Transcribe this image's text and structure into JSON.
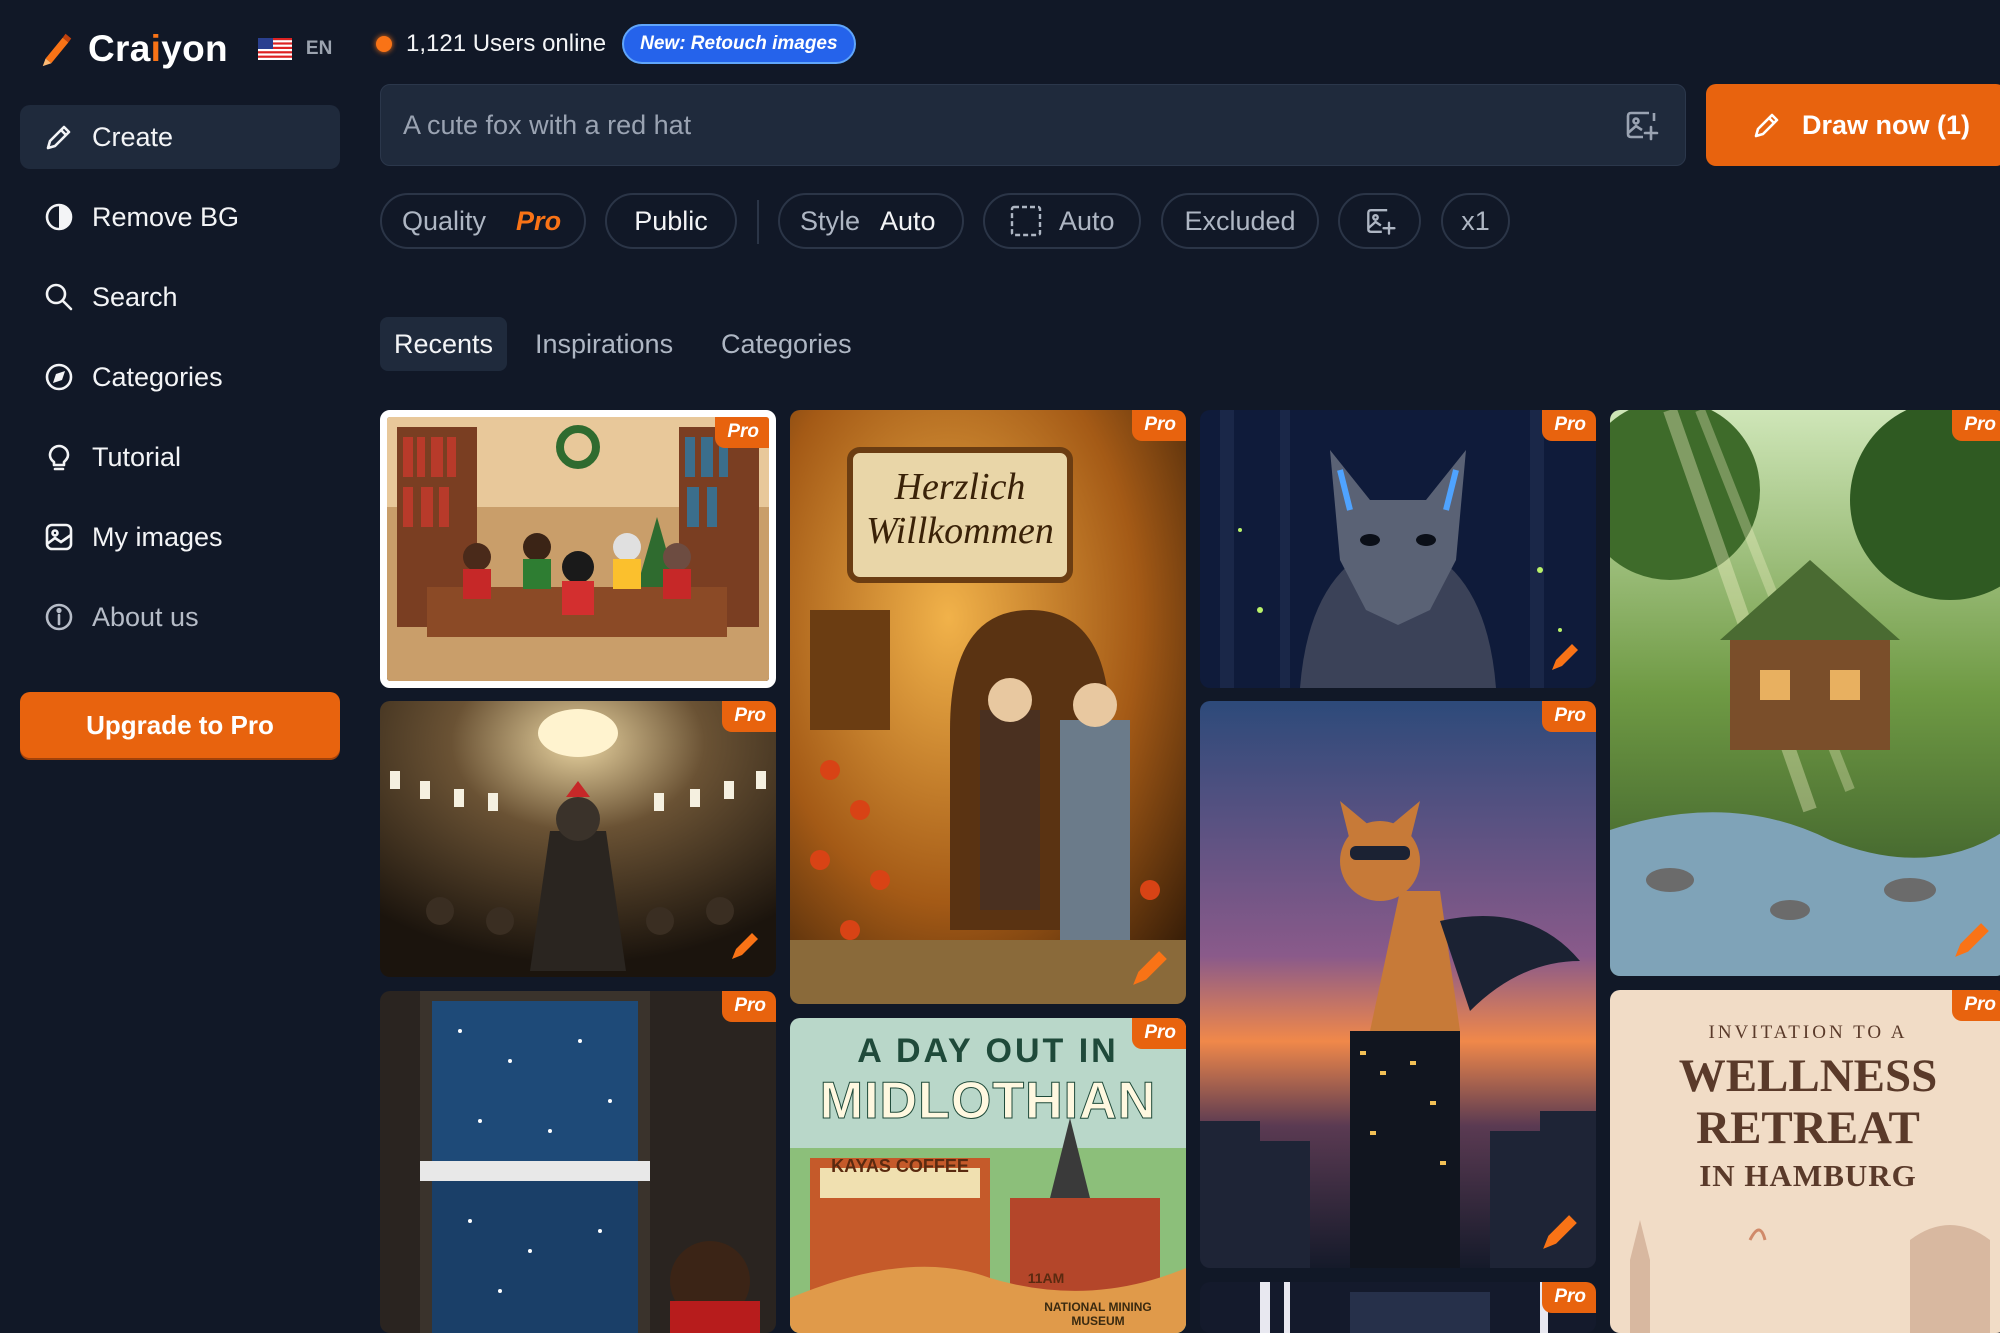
{
  "app": {
    "brand_prefix": "Cra",
    "brand_accent": "i",
    "brand_suffix": "yon",
    "language": "EN",
    "accent_color": "#e8630e"
  },
  "sidebar": {
    "items": [
      {
        "label": "Create",
        "icon": "pencil-icon",
        "active": true
      },
      {
        "label": "Remove BG",
        "icon": "half-circle-icon"
      },
      {
        "label": "Search",
        "icon": "search-icon"
      },
      {
        "label": "Categories",
        "icon": "compass-icon"
      },
      {
        "label": "Tutorial",
        "icon": "lightbulb-icon"
      },
      {
        "label": "My images",
        "icon": "image-icon"
      },
      {
        "label": "About us",
        "icon": "info-icon"
      }
    ],
    "upgrade_label": "Upgrade to Pro"
  },
  "header": {
    "users_online": "1,121 Users online",
    "badge": "New: Retouch images"
  },
  "prompt": {
    "placeholder": "A cute fox with a red hat",
    "value": ""
  },
  "draw_button": "Draw now (1)",
  "options": {
    "quality_label": "Quality",
    "quality_value": "Pro",
    "visibility": "Public",
    "style_label": "Style",
    "style_value": "Auto",
    "ratio_value": "Auto",
    "excluded": "Excluded",
    "count": "x1"
  },
  "tabs": [
    "Recents",
    "Inspirations",
    "Categories"
  ],
  "gallery": {
    "pro_tag": "Pro",
    "card_texts": {
      "sign_line1": "Herzlich",
      "sign_line2": "Willkommen",
      "poster_line1": "A DAY OUT IN",
      "poster_line2": "MIDLOTHIAN",
      "cafe_sign": "KAYAS COFFEE",
      "museum": "NATIONAL MINING MUSEUM",
      "tram_label": "11AM",
      "invite_line1": "INVITATION TO A",
      "invite_line2": "WELLNESS",
      "invite_line3": "RETREAT",
      "invite_line4": "IN HAMBURG"
    }
  }
}
